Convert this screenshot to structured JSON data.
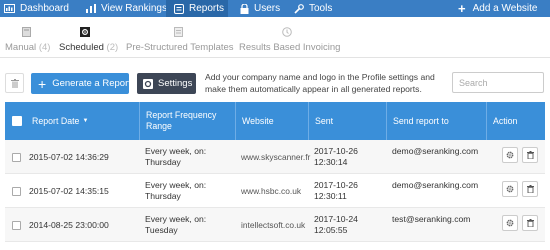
{
  "nav": {
    "dashboard": "Dashboard",
    "view_rankings": "View Rankings",
    "reports": "Reports",
    "users": "Users",
    "tools": "Tools",
    "add_website": "Add a Website"
  },
  "tabs": [
    {
      "label": "Manual",
      "count": "(4)"
    },
    {
      "label": "Scheduled",
      "count": "(2)"
    },
    {
      "label": "Pre-Structured Templates",
      "count": ""
    },
    {
      "label": "Results Based Invoicing",
      "count": ""
    }
  ],
  "toolbar": {
    "generate_label": "Generate a Report",
    "settings_label": "Settings",
    "hint": "Add your company name and logo in the Profile settings and make them automatically appear in all generated reports.",
    "search_placeholder": "Search"
  },
  "table": {
    "headers": {
      "report_date": "Report Date",
      "sort_indicator": "▼",
      "frequency": "Report Frequency Range",
      "website": "Website",
      "sent": "Sent",
      "send_to": "Send report to",
      "action": "Action"
    },
    "rows": [
      {
        "date": "2015-07-02 14:36:29",
        "frequency": "Every week, on: Thursday",
        "website": "www.skyscanner.fr",
        "sent": "2017-10-26 12:30:14",
        "send_to": "demo@seranking.com"
      },
      {
        "date": "2015-07-02 14:35:15",
        "frequency": "Every week, on: Thursday",
        "website": "www.hsbc.co.uk",
        "sent": "2017-10-26 12:30:11",
        "send_to": "demo@seranking.com"
      },
      {
        "date": "2014-08-25 23:00:00",
        "frequency": "Every week, on: Tuesday",
        "website": "intellectsoft.co.uk",
        "sent": "2017-10-24 12:05:55",
        "send_to": "test@seranking.com"
      }
    ]
  },
  "colors": {
    "nav": "#3a7ec4",
    "primary": "#3a8fd9",
    "settings": "#3d4656"
  }
}
